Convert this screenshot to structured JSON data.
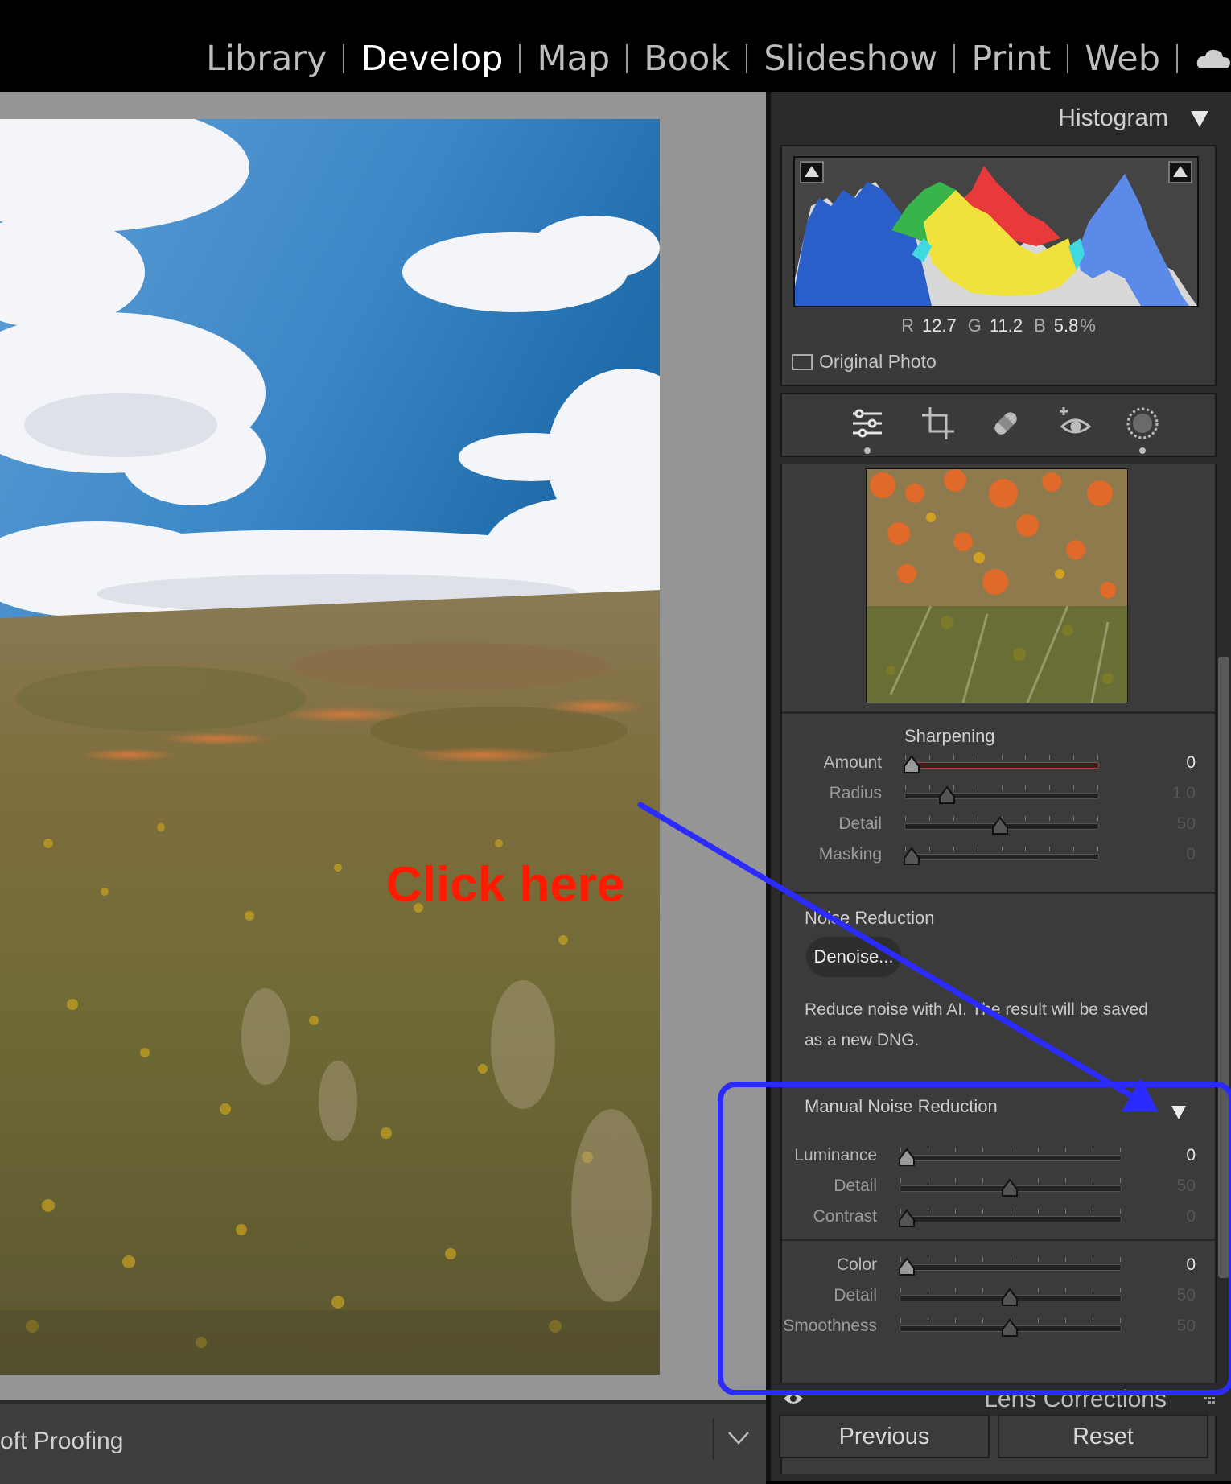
{
  "modules": [
    {
      "label": "Library",
      "active": false
    },
    {
      "label": "Develop",
      "active": true
    },
    {
      "label": "Map",
      "active": false
    },
    {
      "label": "Book",
      "active": false
    },
    {
      "label": "Slideshow",
      "active": false
    },
    {
      "label": "Print",
      "active": false
    },
    {
      "label": "Web",
      "active": false
    }
  ],
  "annotation": {
    "callout": "Click here",
    "color": "#ff1a00",
    "box_color": "#2b2bff"
  },
  "bottom_toolbar": {
    "soft_proofing": "oft Proofing"
  },
  "histogram": {
    "title": "Histogram",
    "r_label": "R",
    "r_value": "12.7",
    "g_label": "G",
    "g_value": "11.2",
    "b_label": "B",
    "b_value": "5.8",
    "percent": "%",
    "original_photo": "Original Photo"
  },
  "tools": [
    "sliders-icon",
    "crop-icon",
    "healing-icon",
    "redeye-icon",
    "masking-icon"
  ],
  "sharpening": {
    "title": "Sharpening",
    "rows": [
      {
        "label": "Amount",
        "value": "0"
      },
      {
        "label": "Radius",
        "value": "1.0"
      },
      {
        "label": "Detail",
        "value": "50"
      },
      {
        "label": "Masking",
        "value": "0"
      }
    ]
  },
  "noise_reduction": {
    "title": "Noise Reduction",
    "denoise_button": "Denoise...",
    "description": "Reduce noise with AI. The result will be saved as a new DNG."
  },
  "manual_noise_reduction": {
    "title": "Manual Noise Reduction",
    "luminance_rows": [
      {
        "label": "Luminance",
        "value": "0"
      },
      {
        "label": "Detail",
        "value": "50"
      },
      {
        "label": "Contrast",
        "value": "0"
      }
    ],
    "color_rows": [
      {
        "label": "Color",
        "value": "0"
      },
      {
        "label": "Detail",
        "value": "50"
      },
      {
        "label": "Smoothness",
        "value": "50"
      }
    ]
  },
  "lens_corrections": "Lens Corrections",
  "footer": {
    "previous": "Previous",
    "reset": "Reset"
  }
}
